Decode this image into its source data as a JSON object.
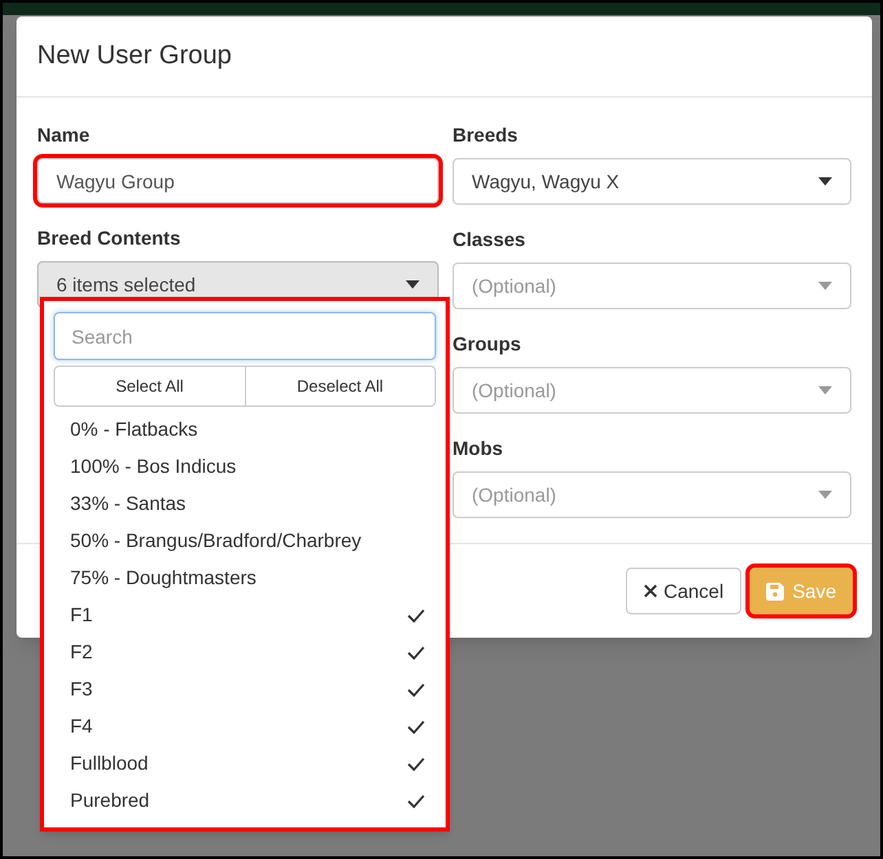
{
  "dialog": {
    "title": "New User Group"
  },
  "left_fields": [
    {
      "label": "Name",
      "kind": "text",
      "value": "Wagyu Group",
      "highlighted": true
    },
    {
      "label": "Breed Contents",
      "kind": "multiselect",
      "value": "6 items selected",
      "expanded": true
    }
  ],
  "right_fields": [
    {
      "label": "Breeds",
      "kind": "select",
      "value": "Wagyu, Wagyu X"
    },
    {
      "label": "Classes",
      "kind": "select",
      "placeholder": "(Optional)"
    },
    {
      "label": "Groups",
      "kind": "select",
      "placeholder": "(Optional)"
    },
    {
      "label": "Mobs",
      "kind": "select",
      "placeholder": "(Optional)"
    }
  ],
  "dropdown": {
    "highlighted": true,
    "search": {
      "placeholder": "Search"
    },
    "select_all": "Select All",
    "deselect_all": "Deselect All",
    "options": [
      {
        "label": "0% - Flatbacks",
        "checked": false
      },
      {
        "label": "100% - Bos Indicus",
        "checked": false
      },
      {
        "label": "33% - Santas",
        "checked": false
      },
      {
        "label": "50% - Brangus/Bradford/Charbrey",
        "checked": false
      },
      {
        "label": "75% - Doughtmasters",
        "checked": false
      },
      {
        "label": "F1",
        "checked": true
      },
      {
        "label": "F2",
        "checked": true
      },
      {
        "label": "F3",
        "checked": true
      },
      {
        "label": "F4",
        "checked": true
      },
      {
        "label": "Fullblood",
        "checked": true
      },
      {
        "label": "Purebred",
        "checked": true
      }
    ]
  },
  "buttons": [
    {
      "label": "Cancel",
      "kind": "cancel",
      "highlighted": false
    },
    {
      "label": "Save",
      "kind": "save",
      "highlighted": true
    }
  ]
}
